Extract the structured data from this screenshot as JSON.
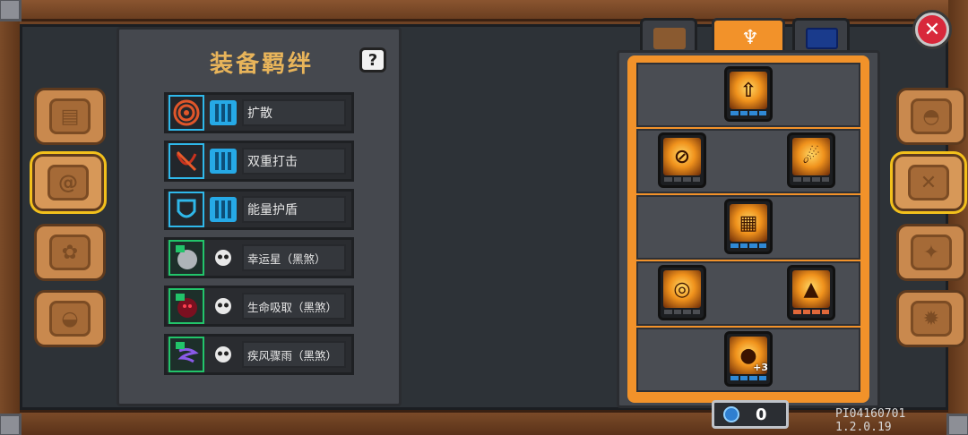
{
  "equipment_panel": {
    "title": "装备羁绊",
    "help_label": "?",
    "rows": [
      {
        "name": "扩散",
        "color": "#e0562a"
      },
      {
        "name": "双重打击",
        "color": "#c8321e"
      },
      {
        "name": "能量护盾",
        "color": "#2fb8ea"
      },
      {
        "name": "幸运星（黑煞）",
        "color": "#cfd3d6"
      },
      {
        "name": "生命吸取（黑煞）",
        "color": "#b02030"
      },
      {
        "name": "疾风骤雨（黑煞）",
        "color": "#7c4ad8"
      }
    ]
  },
  "close_button": {
    "label": "✕"
  },
  "left_tabs": [
    {
      "icon": "book-icon"
    },
    {
      "icon": "swirl-clouds-icon"
    },
    {
      "icon": "flower-icon"
    },
    {
      "icon": "helmet-icon"
    }
  ],
  "right_tabs": [
    {
      "icon": "helmet-icon"
    },
    {
      "icon": "crossed-swords-icon"
    },
    {
      "icon": "compass-star-icon"
    },
    {
      "icon": "gear-icon"
    }
  ],
  "top_tabs": [
    {
      "icon": "weapon-icon"
    },
    {
      "icon": "trident-crest-icon"
    },
    {
      "icon": "blue-banner-icon"
    }
  ],
  "skill_tree": {
    "skills": [
      {
        "icon": "power-up-icon",
        "pips": "blue"
      },
      {
        "icon": "orbit-slash-icon",
        "pips": "grey"
      },
      {
        "icon": "meteor-icon",
        "pips": "grey"
      },
      {
        "icon": "scroll-icon",
        "pips": "blue"
      },
      {
        "icon": "vortex-icon",
        "pips": "grey"
      },
      {
        "icon": "fire-giant-icon",
        "pips": "orange"
      },
      {
        "icon": "golden-pet-icon",
        "pips": "blue",
        "badge": "+3"
      }
    ]
  },
  "currency": {
    "value": "0"
  },
  "version": "PI04160701 1.2.0.19"
}
